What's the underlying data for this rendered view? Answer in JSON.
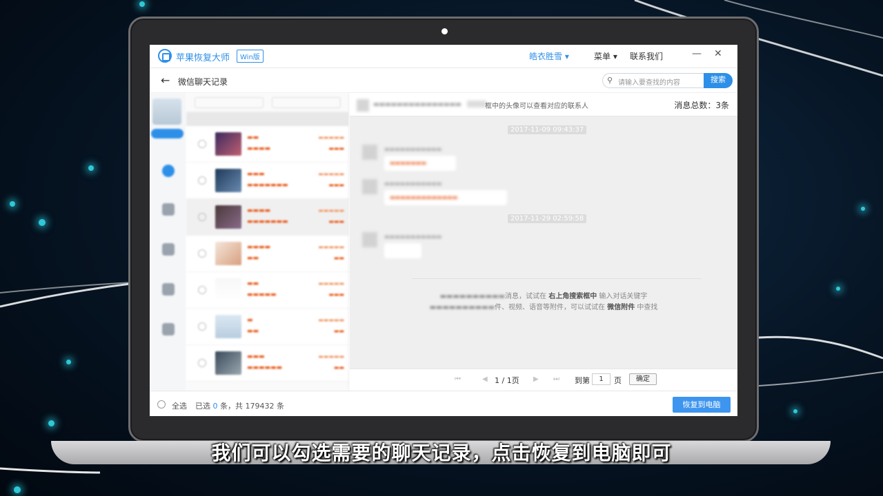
{
  "app": {
    "name": "苹果恢复大师",
    "edition": "Win版",
    "user": "皓衣胜雪 ▾",
    "menu": "菜单 ▾",
    "contact": "联系我们",
    "minimize": "—",
    "close": "✕"
  },
  "toolbar": {
    "back": "←",
    "title": "微信聊天记录",
    "search_placeholder": "请输入要查找的内容",
    "search_button": "搜索"
  },
  "chat": {
    "header_hint": "框中的头像可以查看对应的联系人",
    "total": "消息总数：3条",
    "timestamps": [
      "2017-11-09 09:43:37",
      "2017-11-29 02:59:58"
    ],
    "tip_line1_suffix": "消息，试试在",
    "tip_line1_bold": "右上角搜索框中",
    "tip_line1_end": "输入对话关键字",
    "tip_line2_suffix": "件、视频、语音等附件，可以试试在",
    "tip_line2_bold": "微信附件",
    "tip_line2_end": "中查找"
  },
  "pager": {
    "info": "1 / 1页",
    "goto_label": "到第",
    "goto_value": "1",
    "page_unit": "页",
    "confirm": "确定"
  },
  "footer": {
    "select_all": "全选",
    "selected_prefix": "已选",
    "selected_count": "0",
    "selected_suffix": "条，共 179432 条",
    "recover_button": "恢复到电脑"
  },
  "subtitle": "我们可以勾选需要的聊天记录，点击恢复到电脑即可",
  "colors": {
    "accent": "#2e8fe8",
    "highlight": "#e85a1a"
  }
}
